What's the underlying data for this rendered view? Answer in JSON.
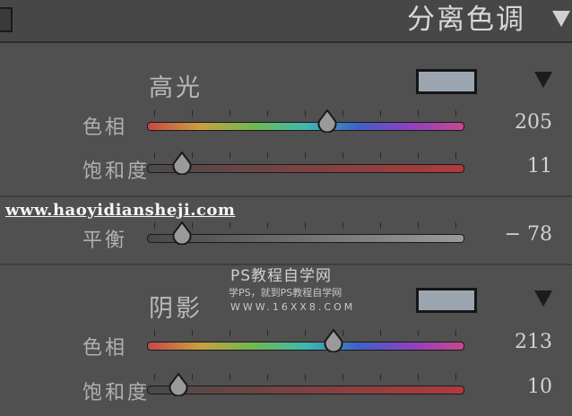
{
  "panel": {
    "title": "分离色调",
    "watermark": {
      "url": "www.haoyidiansheji.com",
      "site_name": "PS教程自学网",
      "slogan": "学PS，就到PS教程自学网",
      "domain": "WWW.16XX8.COM"
    }
  },
  "highlights": {
    "label": "高光",
    "swatch_color": "#9aa5b0",
    "hue": {
      "label": "色相",
      "value": "205",
      "level": 0.57
    },
    "saturation": {
      "label": "饱和度",
      "value": "11",
      "level": 0.11
    }
  },
  "balance": {
    "label": "平衡",
    "value": "− 78",
    "level": 0.11
  },
  "shadows": {
    "label": "阴影",
    "swatch_color": "#9aa5b0",
    "hue": {
      "label": "色相",
      "value": "213",
      "level": 0.59
    },
    "saturation": {
      "label": "饱和度",
      "value": "10",
      "level": 0.1
    }
  },
  "colors": {
    "hue_gradient": [
      "#c84848",
      "#c8a040",
      "#70b850",
      "#40b8b0",
      "#4060c8",
      "#9040c0",
      "#c84890"
    ],
    "saturation_gradient": [
      "#4a4a4a",
      "#b03a3a"
    ],
    "balance_gradient": [
      "#484848",
      "#9a9a9a"
    ]
  },
  "icons": {
    "collapse_header": "triangle-down-icon",
    "collapse_section": "triangle-down-icon",
    "thumb": "slider-thumb-icon"
  }
}
